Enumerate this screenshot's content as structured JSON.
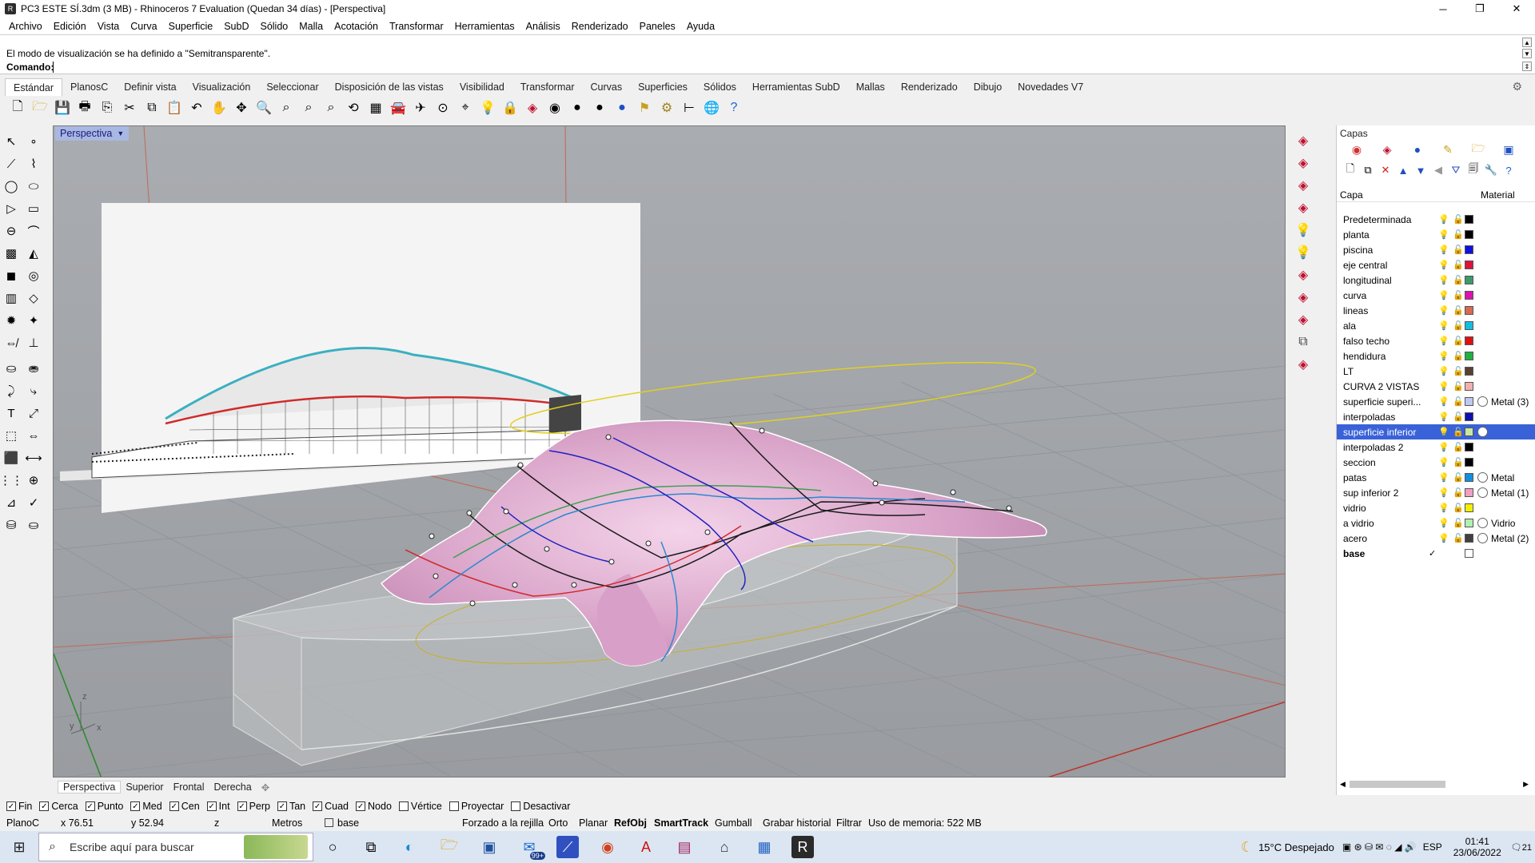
{
  "window": {
    "title": "PC3 ESTE SÍ.3dm (3 MB) - Rhinoceros 7 Evaluation (Quedan 34 días) - [Perspectiva]"
  },
  "menu": [
    "Archivo",
    "Edición",
    "Vista",
    "Curva",
    "Superficie",
    "SubD",
    "Sólido",
    "Malla",
    "Acotación",
    "Transformar",
    "Herramientas",
    "Análisis",
    "Renderizado",
    "Paneles",
    "Ayuda"
  ],
  "command": {
    "history": "El modo de visualización se ha definido a \"Semitransparente\".",
    "prompt": "Comando:"
  },
  "tabs": [
    "Estándar",
    "PlanosC",
    "Definir vista",
    "Visualización",
    "Seleccionar",
    "Disposición de las vistas",
    "Visibilidad",
    "Transformar",
    "Curvas",
    "Superficies",
    "Sólidos",
    "Herramientas SubD",
    "Mallas",
    "Renderizado",
    "Dibujo",
    "Novedades V7"
  ],
  "viewport": {
    "label": "Perspectiva"
  },
  "view_tabs": [
    "Perspectiva",
    "Superior",
    "Frontal",
    "Derecha"
  ],
  "layers_panel": {
    "title": "Capas",
    "col_layer": "Capa",
    "col_material": "Material",
    "layers": [
      {
        "name": "Predeterminada",
        "color": "#000000",
        "material": ""
      },
      {
        "name": "planta",
        "color": "#000000",
        "material": ""
      },
      {
        "name": "piscina",
        "color": "#1010e0",
        "material": ""
      },
      {
        "name": "eje central",
        "color": "#e0103a",
        "material": ""
      },
      {
        "name": "longitudinal",
        "color": "#3c9a6a",
        "material": ""
      },
      {
        "name": "curva",
        "color": "#e010b0",
        "material": ""
      },
      {
        "name": "lineas",
        "color": "#d86a50",
        "material": ""
      },
      {
        "name": "ala",
        "color": "#10c0e0",
        "material": ""
      },
      {
        "name": "falso techo",
        "color": "#e01010",
        "material": ""
      },
      {
        "name": "hendidura",
        "color": "#20b040",
        "material": ""
      },
      {
        "name": "LT",
        "color": "#5a4030",
        "material": ""
      },
      {
        "name": "CURVA 2 VISTAS",
        "color": "#f0b0b0",
        "material": ""
      },
      {
        "name": "superficie superi...",
        "color": "#c0c8f0",
        "material": "Metal (3)"
      },
      {
        "name": "interpoladas",
        "color": "#1010b0",
        "material": ""
      },
      {
        "name": "superficie inferior",
        "color": "#c8e8a0",
        "material": "",
        "selected": true
      },
      {
        "name": "interpoladas 2",
        "color": "#000000",
        "material": ""
      },
      {
        "name": "seccion",
        "color": "#000000",
        "material": ""
      },
      {
        "name": "patas",
        "color": "#1090e0",
        "material": "Metal"
      },
      {
        "name": "sup inferior 2",
        "color": "#f0a0c0",
        "material": "Metal (1)"
      },
      {
        "name": "vidrio",
        "color": "#f0f000",
        "material": ""
      },
      {
        "name": "a vidrio",
        "color": "#b0f0b0",
        "material": "Vidrio"
      },
      {
        "name": "acero",
        "color": "#404040",
        "material": "Metal (2)"
      },
      {
        "name": "base",
        "color": "#ffffff",
        "material": "",
        "current": true
      }
    ]
  },
  "osnaps": [
    {
      "label": "Fin",
      "checked": true
    },
    {
      "label": "Cerca",
      "checked": true
    },
    {
      "label": "Punto",
      "checked": true
    },
    {
      "label": "Med",
      "checked": true
    },
    {
      "label": "Cen",
      "checked": true
    },
    {
      "label": "Int",
      "checked": true
    },
    {
      "label": "Perp",
      "checked": true
    },
    {
      "label": "Tan",
      "checked": true
    },
    {
      "label": "Cuad",
      "checked": true
    },
    {
      "label": "Nodo",
      "checked": true
    },
    {
      "label": "Vértice",
      "checked": false
    },
    {
      "label": "Proyectar",
      "checked": false
    },
    {
      "label": "Desactivar",
      "checked": false
    }
  ],
  "status": {
    "cplane": "PlanoC",
    "x": "x 76.51",
    "y": "y 52.94",
    "z": "z",
    "units": "Metros",
    "layer": "base",
    "grid_snap": "Forzado a la rejilla",
    "ortho": "Orto",
    "planar": "Planar",
    "osnap": "RefObj",
    "smarttrack": "SmartTrack",
    "gumball": "Gumball",
    "history": "Grabar historial",
    "filter": "Filtrar",
    "memory": "Uso de memoria: 522 MB"
  },
  "taskbar": {
    "search_placeholder": "Escribe aquí para buscar",
    "mail_badge": "99+",
    "weather": "15°C  Despejado",
    "lang": "ESP",
    "time": "01:41",
    "date": "23/06/2022",
    "notif": "21"
  }
}
